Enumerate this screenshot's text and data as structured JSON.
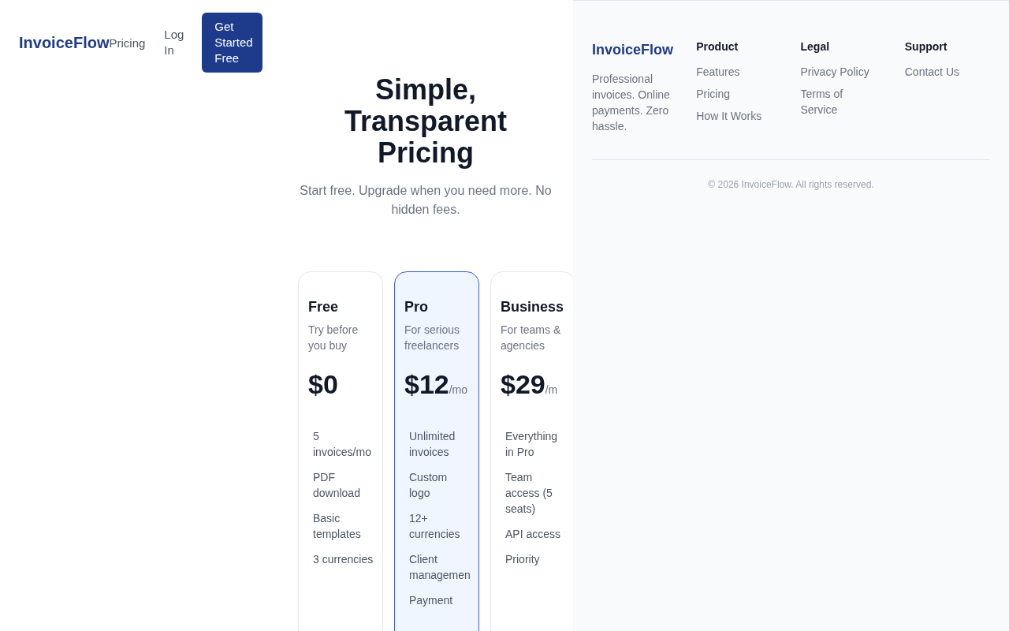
{
  "header": {
    "logo": "InvoiceFlow",
    "nav": [
      "Pricing",
      "Log In"
    ],
    "cta": "Get Started Free"
  },
  "hero": {
    "title": "Simple, Transparent Pricing",
    "subtitle": "Start free. Upgrade when you need more. No hidden fees."
  },
  "plans": [
    {
      "name": "Free",
      "tagline": "Try before you buy",
      "price": "$0",
      "highlighted": false,
      "features": [
        "5 invoices/mo",
        "PDF download",
        "Basic templates",
        "3 currencies"
      ]
    },
    {
      "name": "Pro",
      "tagline": "For serious freelancers",
      "price": "$12",
      "period": "/mo",
      "highlighted": true,
      "features": [
        "Unlimited invoices",
        "Custom logo",
        "12+ currencies",
        "Client managemen",
        "Payment"
      ]
    },
    {
      "name": "Business",
      "tagline": "For teams & agencies",
      "price": "$29",
      "period": "/m",
      "highlighted": false,
      "features": [
        "Everything in Pro",
        "Team access (5 seats)",
        "API access",
        "Priority"
      ]
    }
  ],
  "footer": {
    "logo": "InvoiceFlow",
    "description": "Professional invoices. Online payments. Zero hassle.",
    "columns": [
      {
        "heading": "Product",
        "links": [
          "Features",
          "Pricing",
          "How It Works"
        ]
      },
      {
        "heading": "Legal",
        "links": [
          "Privacy Policy",
          "Terms of Service"
        ]
      },
      {
        "heading": "Support",
        "links": [
          "Contact Us"
        ]
      }
    ],
    "copyright": "© 2026 InvoiceFlow. All rights reserved."
  }
}
